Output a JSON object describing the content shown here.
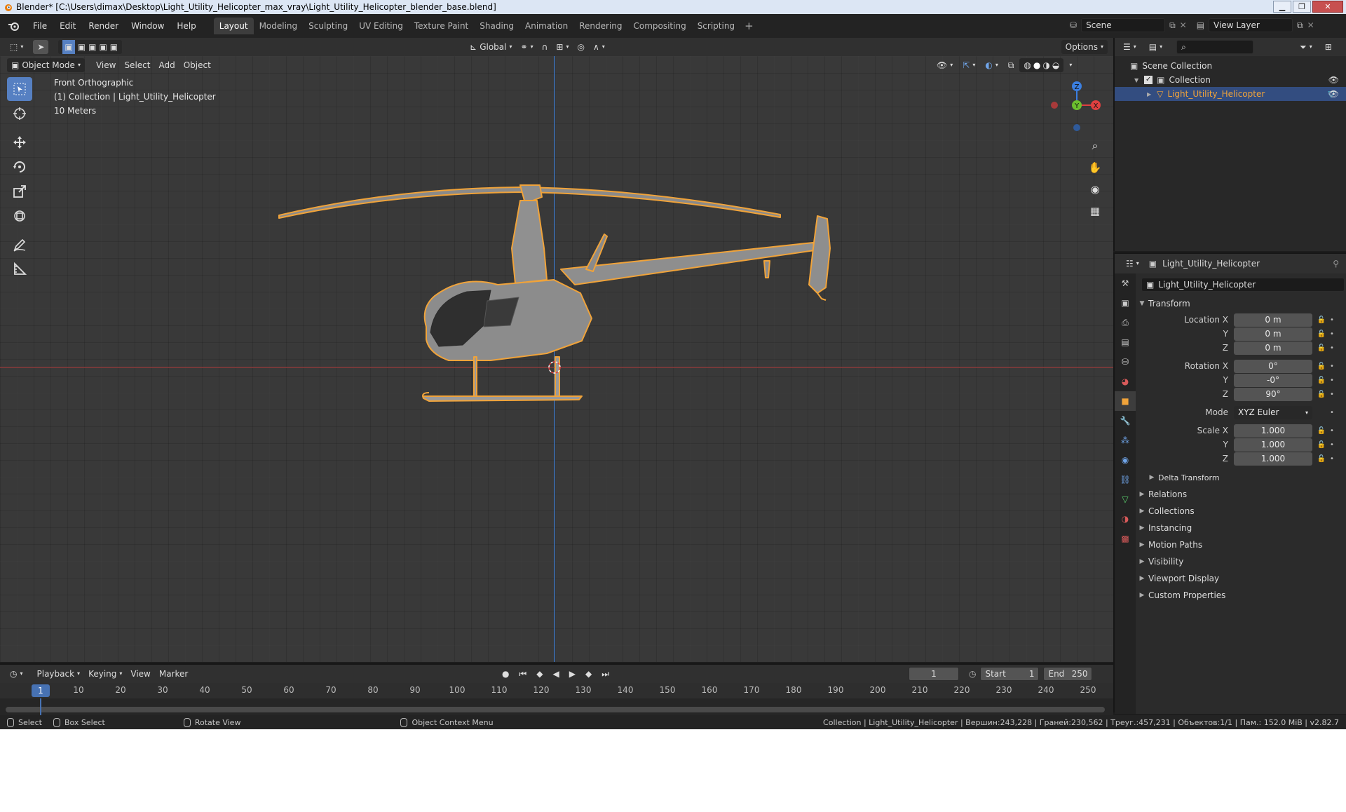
{
  "window": {
    "title": "Blender* [C:\\Users\\dimax\\Desktop\\Light_Utility_Helicopter_max_vray\\Light_Utility_Helicopter_blender_base.blend]"
  },
  "menu": {
    "items": [
      "File",
      "Edit",
      "Render",
      "Window",
      "Help"
    ]
  },
  "workspaces": {
    "tabs": [
      "Layout",
      "Modeling",
      "Sculpting",
      "UV Editing",
      "Texture Paint",
      "Shading",
      "Animation",
      "Rendering",
      "Compositing",
      "Scripting"
    ],
    "active": "Layout"
  },
  "scene": {
    "name": "Scene",
    "view_layer": "View Layer"
  },
  "viewport_header": {
    "transform_orientation": "Global",
    "options_label": "Options",
    "mode": "Object Mode",
    "menus": [
      "View",
      "Select",
      "Add",
      "Object"
    ]
  },
  "viewport_info": {
    "view": "Front Orthographic",
    "collection": "(1) Collection | Light_Utility_Helicopter",
    "scale": "10 Meters"
  },
  "gizmo": {
    "z": "Z",
    "y": "Y",
    "x": "X"
  },
  "outliner": {
    "scene_collection": "Scene Collection",
    "collection": "Collection",
    "object": "Light_Utility_Helicopter"
  },
  "properties": {
    "header_object": "Light_Utility_Helicopter",
    "object_name": "Light_Utility_Helicopter",
    "transform": {
      "title": "Transform",
      "location_label": "Location X",
      "location": [
        "0 m",
        "0 m",
        "0 m"
      ],
      "rotation_label": "Rotation X",
      "rotation": [
        "0°",
        "-0°",
        "90°"
      ],
      "mode_label": "Mode",
      "mode": "XYZ Euler",
      "scale_label": "Scale X",
      "scale": [
        "1.000",
        "1.000",
        "1.000"
      ],
      "axis_y": "Y",
      "axis_z": "Z",
      "delta": "Delta Transform"
    },
    "panels": [
      "Relations",
      "Collections",
      "Instancing",
      "Motion Paths",
      "Visibility",
      "Viewport Display",
      "Custom Properties"
    ]
  },
  "timeline": {
    "menus": [
      "Playback",
      "Keying",
      "View",
      "Marker"
    ],
    "current_frame": "1",
    "start_label": "Start",
    "start": "1",
    "end_label": "End",
    "end": "250",
    "ruler": [
      "1",
      "10",
      "20",
      "30",
      "40",
      "50",
      "60",
      "70",
      "80",
      "90",
      "100",
      "110",
      "120",
      "130",
      "140",
      "150",
      "160",
      "170",
      "180",
      "190",
      "200",
      "210",
      "220",
      "230",
      "240",
      "250"
    ]
  },
  "statusbar": {
    "select": "Select",
    "box_select": "Box Select",
    "rotate_view": "Rotate View",
    "context_menu": "Object Context Menu",
    "stats": "Collection | Light_Utility_Helicopter | Вершин:243,228 | Граней:230,562 | Треуг.:457,231 | Объектов:1/1 | Пам.: 152.0 MiB | v2.82.7"
  }
}
